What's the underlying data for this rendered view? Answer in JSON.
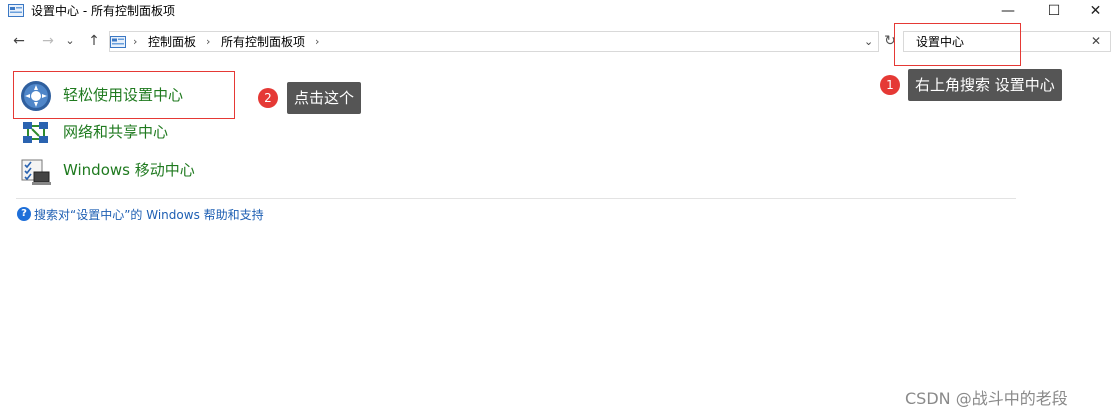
{
  "window": {
    "title": "设置中心 - 所有控制面板项",
    "minimize_glyph": "—",
    "maximize_glyph": "☐",
    "close_glyph": "✕"
  },
  "nav": {
    "back_glyph": "←",
    "forward_glyph": "→",
    "recent_glyph": "⌄",
    "up_glyph": "↑"
  },
  "address": {
    "crumbs": [
      "控制面板",
      "所有控制面板项"
    ],
    "separator": "›",
    "dropdown_glyph": "⌄",
    "refresh_glyph": "↻"
  },
  "search": {
    "value": "设置中心",
    "clear_glyph": "✕"
  },
  "results": [
    {
      "label": "轻松使用设置中心",
      "icon": "ease-of-access-icon"
    },
    {
      "label": "网络和共享中心",
      "icon": "network-sharing-icon"
    },
    {
      "label": "Windows 移动中心",
      "icon": "mobility-center-icon"
    }
  ],
  "help": {
    "icon_glyph": "?",
    "link": "搜索对“设置中心”的 Windows 帮助和支持"
  },
  "annotations": {
    "step1": {
      "number": "1",
      "text": "右上角搜索 设置中心"
    },
    "step2": {
      "number": "2",
      "text": "点击这个"
    }
  },
  "watermark": "CSDN @战斗中的老段",
  "colors": {
    "link_green": "#1f7a1f",
    "annotation_red": "#e53935",
    "callout_gray": "#555555",
    "help_blue": "#1e5fb3"
  }
}
